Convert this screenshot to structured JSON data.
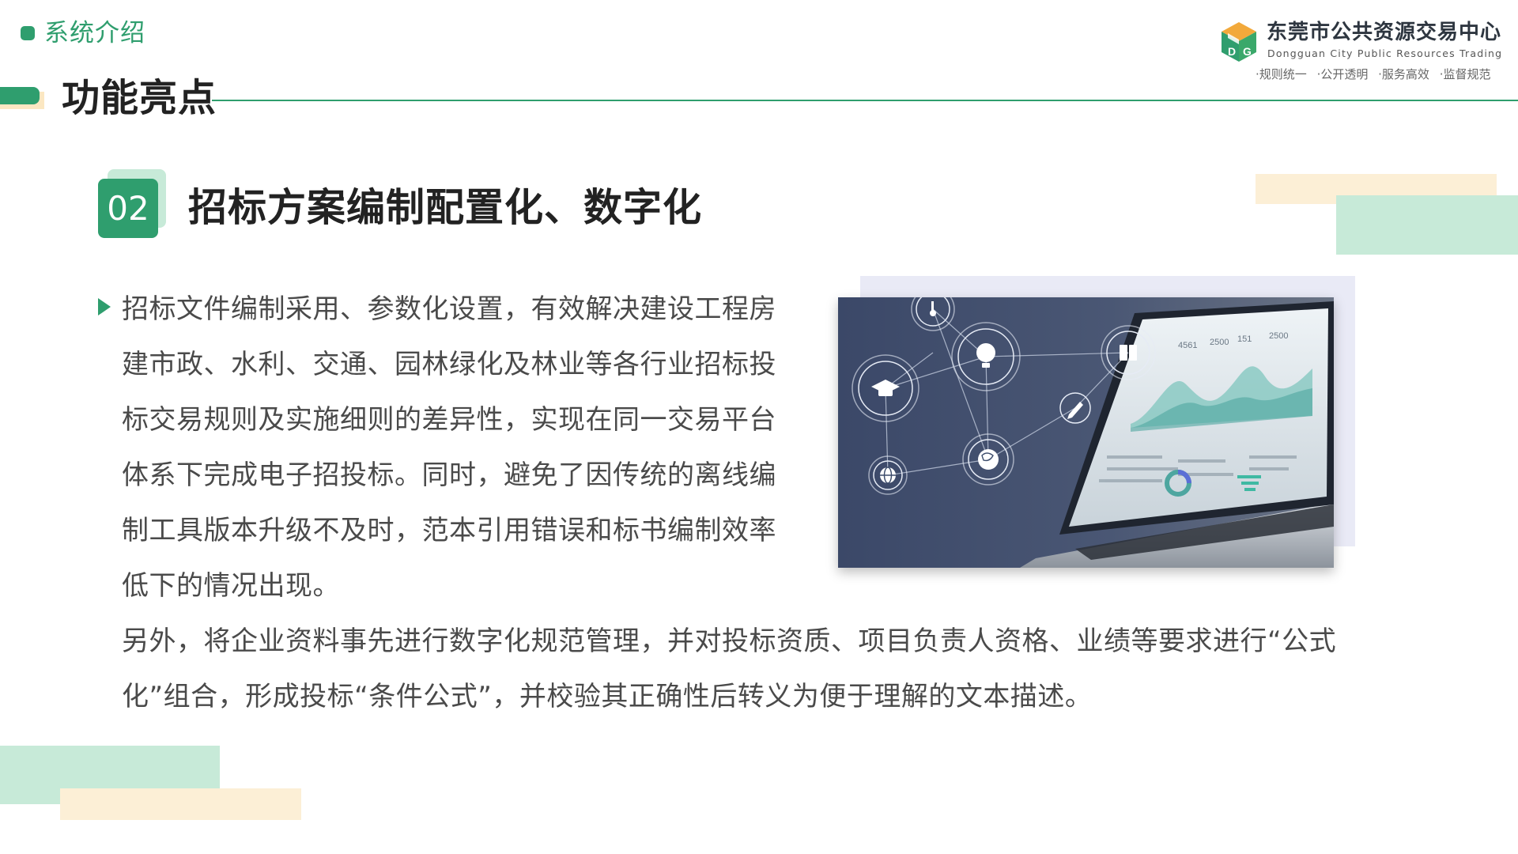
{
  "header": {
    "section_label": "系统介绍",
    "page_title": "功能亮点"
  },
  "brand": {
    "name_cn": "东莞市公共资源交易中心",
    "name_en": "Dongguan City Public Resources Trading",
    "slogans": [
      "·规则统一",
      "·公开透明",
      "·服务高效",
      "·监督规范"
    ],
    "logo_icon": "cube-logo-icon"
  },
  "feature": {
    "number": "02",
    "title": "招标方案编制配置化、数字化",
    "paragraph_1": "招标文件编制采用、参数化设置，有效解决建设工程房建市政、水利、交通、园林绿化及林业等各行业招标投标交易规则及实施细则的差异性，实现在同一交易平台体系下完成电子招投标。同时，避免了因传统的离线编制工具版本升级不及时，范本引用错误和标书编制效率低下的情况出现。",
    "paragraph_2": "另外，将企业资料事先进行数字化规范管理，并对投标资质、项目负责人资格、业绩等要求进行“公式化”组合，形成投标“条件公式”，并校验其正确性后转义为便于理解的文本描述。"
  },
  "colors": {
    "accent_green": "#2f9e6e",
    "light_green": "#c7ead8",
    "light_yellow": "#fcefd6",
    "text_dark": "#222222",
    "text_body": "#4a4a4a"
  }
}
